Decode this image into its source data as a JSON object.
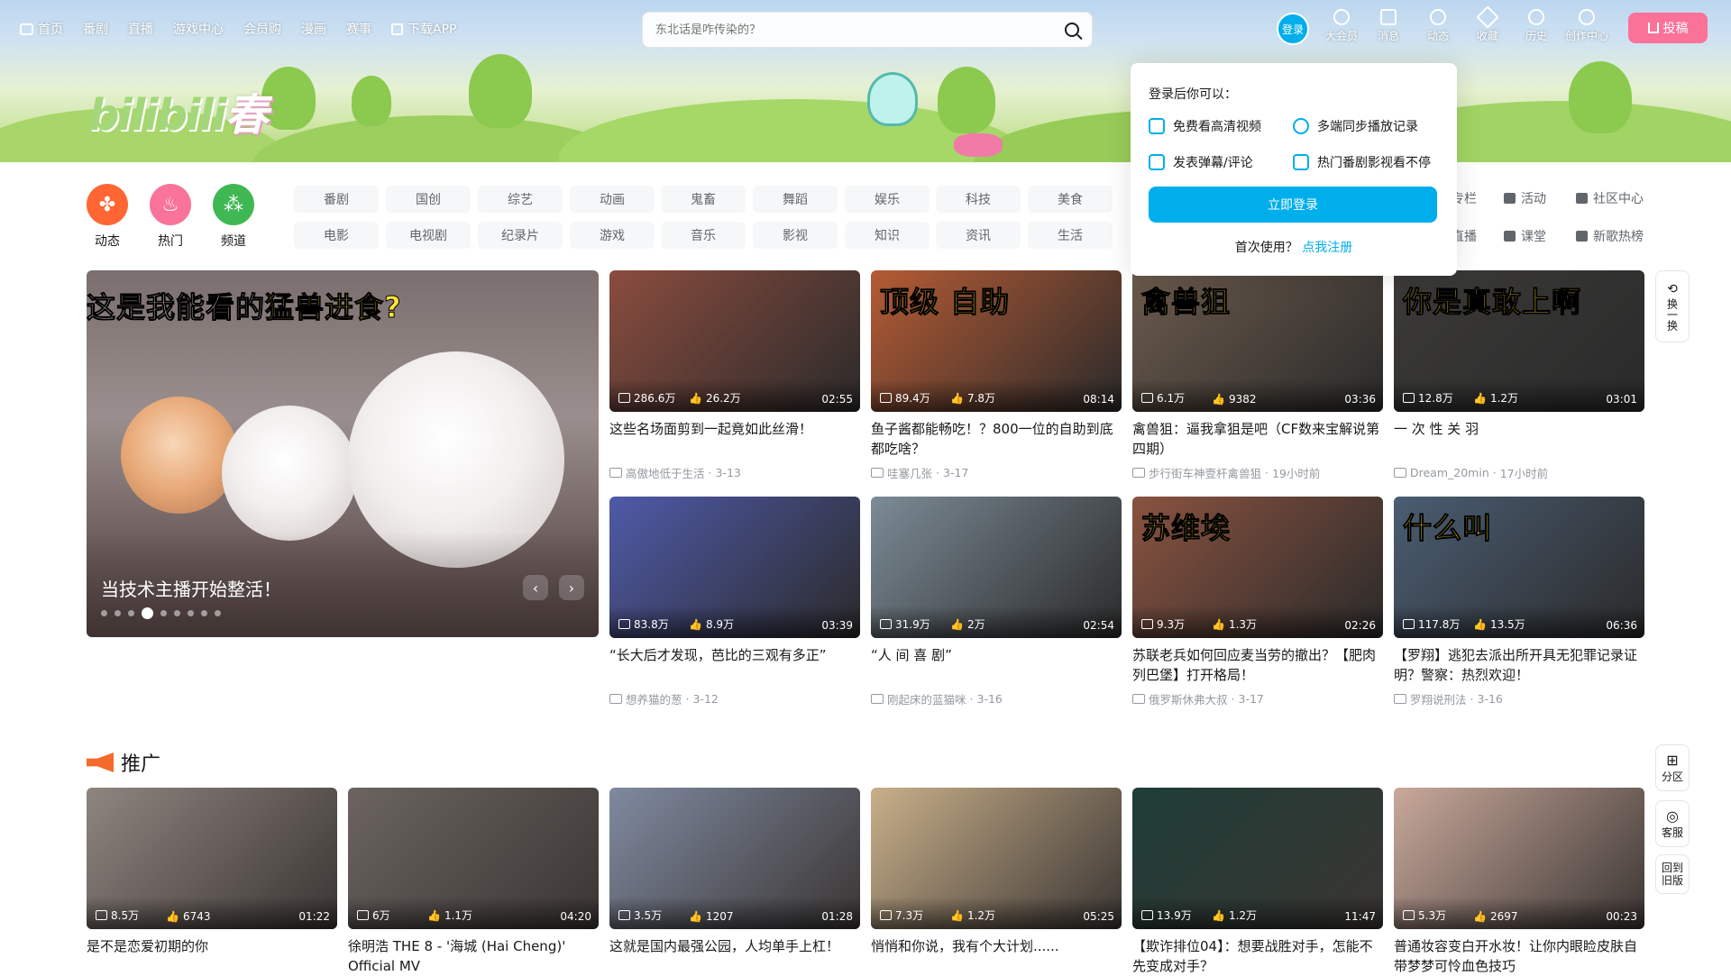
{
  "nav": {
    "items": [
      "首页",
      "番剧",
      "直播",
      "游戏中心",
      "会员购",
      "漫画",
      "赛事",
      "下载APP"
    ],
    "search_placeholder": "东北话是咋传染的？",
    "login": "登录",
    "right": [
      "大会员",
      "消息",
      "动态",
      "收藏",
      "历史",
      "创作中心"
    ],
    "upload": "投稿"
  },
  "brand": {
    "logo": "bilibili"
  },
  "channels": {
    "big": [
      {
        "label": "动态",
        "color": "#ff6633"
      },
      {
        "label": "热门",
        "color": "#f9739b"
      },
      {
        "label": "频道",
        "color": "#3fb854"
      }
    ],
    "row1": [
      "番剧",
      "国创",
      "综艺",
      "动画",
      "鬼畜",
      "舞蹈",
      "娱乐",
      "科技",
      "美食"
    ],
    "row2": [
      "电影",
      "电视剧",
      "纪录片",
      "游戏",
      "音乐",
      "影视",
      "知识",
      "资讯",
      "生活"
    ],
    "side": [
      "专栏",
      "活动",
      "社区中心",
      "直播",
      "课堂",
      "新歌热榜"
    ]
  },
  "carousel": {
    "headline_a": "这是我能看的",
    "headline_b": "猛兽进食?",
    "caption": "当技术主播开始整活！"
  },
  "videos": [
    {
      "title": "这些名场面剪到一起竟如此丝滑！",
      "author": "高傲地低于生活",
      "date": "3-13",
      "views": "286.6万",
      "likes": "26.2万",
      "duration": "02:55",
      "bg": "#8a4c3e",
      "overlay": ""
    },
    {
      "title": "鱼子酱都能畅吃！？800一位的自助到底都吃啥？",
      "author": "哇塞几张",
      "date": "3-17",
      "views": "89.4万",
      "likes": "7.8万",
      "duration": "08:14",
      "bg": "#b55b34",
      "overlay": "顶级 自助"
    },
    {
      "title": "禽兽狙：逼我拿狙是吧（CF数来宝解说第四期）",
      "author": "步行街车神壹杆禽兽狙",
      "date": "19小时前",
      "views": "6.1万",
      "likes": "9382",
      "duration": "03:36",
      "bg": "#6b5a4c",
      "overlay": "禽兽狙"
    },
    {
      "title": "一 次 性 关 羽",
      "author": "Dream_20min",
      "date": "17小时前",
      "views": "12.8万",
      "likes": "1.2万",
      "duration": "03:01",
      "bg": "#3b3a38",
      "overlay": "你是真敢上啊"
    },
    {
      "title": "“长大后才发现，芭比的三观有多正”",
      "author": "想养猫的葱",
      "date": "3-12",
      "views": "83.8万",
      "likes": "8.9万",
      "duration": "03:39",
      "bg": "#4f5aa8",
      "overlay": ""
    },
    {
      "title": "“人 间 喜 剧”",
      "author": "刚起床的蓝猫咪",
      "date": "3-16",
      "views": "31.9万",
      "likes": "2万",
      "duration": "02:54",
      "bg": "#7c8b96",
      "overlay": ""
    },
    {
      "title": "苏联老兵如何回应麦当劳的撤出？【肥肉列巴堡】打开格局！",
      "author": "俄罗斯休弗大叔",
      "date": "3-17",
      "views": "9.3万",
      "likes": "1.3万",
      "duration": "02:26",
      "bg": "#8a5340",
      "overlay": "苏维埃"
    },
    {
      "title": "【罗翔】逃犯去派出所开具无犯罪记录证明？警察：热烈欢迎！",
      "author": "罗翔说刑法",
      "date": "3-16",
      "views": "117.8万",
      "likes": "13.5万",
      "duration": "06:36",
      "bg": "#4a5d72",
      "overlay": "什么叫"
    }
  ],
  "popup": {
    "title": "登录后你可以：",
    "features": [
      "免费看高清视频",
      "多端同步播放记录",
      "发表弹幕/评论",
      "热门番剧影视看不停"
    ],
    "button": "立即登录",
    "first_use": "首次使用？",
    "register": "点我注册"
  },
  "float": {
    "refresh": "换一换",
    "category": "分区",
    "service": "客服",
    "old": "回到旧版"
  },
  "section": {
    "title": "推广"
  },
  "promos": [
    {
      "title": "是不是恋爱初期的你",
      "views": "8.5万",
      "likes": "6743",
      "duration": "01:22",
      "bg": "#8f8580"
    },
    {
      "title": "徐明浩 THE 8 - '海城 (Hai Cheng)' Official MV",
      "views": "6万",
      "likes": "1.1万",
      "duration": "04:20",
      "bg": "#6b6461"
    },
    {
      "title": "这就是国内最强公园，人均单手上杠！",
      "views": "3.5万",
      "likes": "1207",
      "duration": "01:28",
      "bg": "#7f8aa0"
    },
    {
      "title": "悄悄和你说，我有个大计划......",
      "views": "7.3万",
      "likes": "1.2万",
      "duration": "05:25",
      "bg": "#c9b08a"
    },
    {
      "title": "【欺诈排位04】：想要战胜对手，怎能不先变成对手？",
      "views": "13.9万",
      "likes": "1.2万",
      "duration": "11:47",
      "bg": "#1f3d36"
    },
    {
      "title": "普通妆容变白开水妆！让你内眼睑皮肤自带梦梦可怜血色技巧",
      "views": "5.3万",
      "likes": "2697",
      "duration": "00:23",
      "bg": "#c9a99b"
    }
  ]
}
